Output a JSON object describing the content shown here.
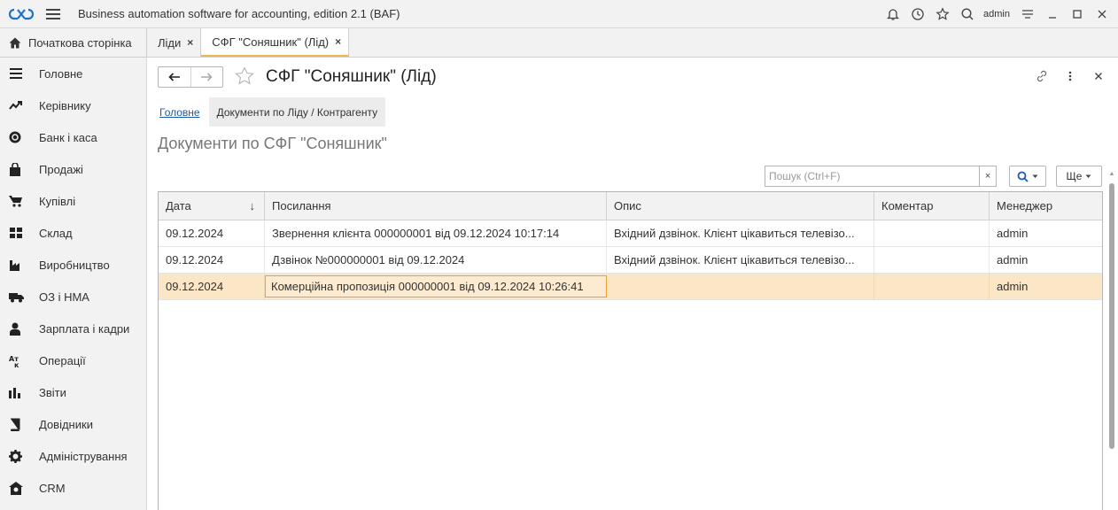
{
  "app": {
    "title": "Business automation software for accounting, edition 2.1  (BAF)",
    "user": "admin"
  },
  "tabs": {
    "home": "Початкова сторінка",
    "items": [
      {
        "label": "Ліди",
        "close": "×"
      },
      {
        "label": "СФГ \"Соняшник\" (Лід)",
        "close": "×"
      }
    ]
  },
  "sidebar": {
    "items": [
      {
        "label": "Головне",
        "icon": "menu-lines-icon"
      },
      {
        "label": "Керівнику",
        "icon": "trend-up-icon"
      },
      {
        "label": "Банк і каса",
        "icon": "coin-icon"
      },
      {
        "label": "Продажі",
        "icon": "shopping-bag-icon"
      },
      {
        "label": "Купівлі",
        "icon": "cart-icon"
      },
      {
        "label": "Склад",
        "icon": "warehouse-icon"
      },
      {
        "label": "Виробництво",
        "icon": "factory-icon"
      },
      {
        "label": "ОЗ і НМА",
        "icon": "truck-icon"
      },
      {
        "label": "Зарплата і кадри",
        "icon": "person-icon"
      },
      {
        "label": "Операції",
        "icon": "operations-icon"
      },
      {
        "label": "Звіти",
        "icon": "bar-chart-icon"
      },
      {
        "label": "Довідники",
        "icon": "book-icon"
      },
      {
        "label": "Адміністрування",
        "icon": "gear-icon"
      },
      {
        "label": "CRM",
        "icon": "crm-icon"
      }
    ]
  },
  "document": {
    "title": "СФГ \"Соняшник\" (Лід)",
    "subnav_link": "Головне",
    "subnav_active": "Документи по Ліду / Контрагенту",
    "section_title": "Документи по СФГ \"Соняшник\""
  },
  "toolbar": {
    "search_placeholder": "Пошук (Ctrl+F)",
    "search_clear": "×",
    "more_label": "Ще"
  },
  "table": {
    "columns": [
      "Дата",
      "Посилання",
      "Опис",
      "Коментар",
      "Менеджер"
    ],
    "sort_indicator": "↓",
    "rows": [
      {
        "date": "09.12.2024",
        "link": "Звернення клієнта 000000001 від 09.12.2024 10:17:14",
        "desc": "Вхідний дзвінок. Клієнт цікавиться телевізо...",
        "comment": "",
        "manager": "admin"
      },
      {
        "date": "09.12.2024",
        "link": "Дзвінок №000000001 від 09.12.2024",
        "desc": "Вхідний дзвінок. Клієнт цікавиться телевізо...",
        "comment": "",
        "manager": "admin"
      },
      {
        "date": "09.12.2024",
        "link": "Комерційна пропозиція 000000001 від 09.12.2024 10:26:41",
        "desc": "",
        "comment": "",
        "manager": "admin"
      }
    ]
  },
  "colors": {
    "accent": "#f0b84a",
    "selected_row": "#fbe7c6",
    "link": "#1e5aa8"
  }
}
